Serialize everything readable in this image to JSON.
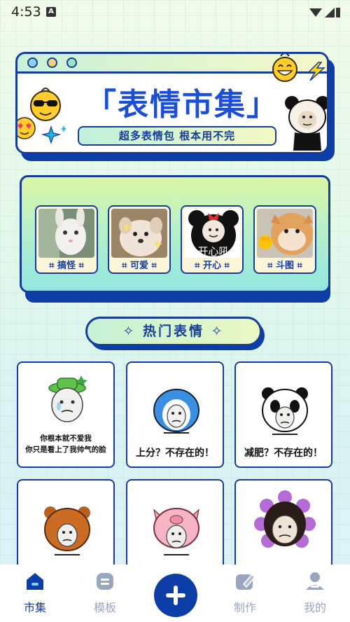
{
  "status_bar": {
    "time": "4:53",
    "notification_glyph": "A"
  },
  "hero": {
    "bracket_left": "「",
    "title": "表情市集",
    "bracket_right": "」",
    "subtitle": "超多表情包 根本用不完"
  },
  "categories": [
    {
      "label": "搞怪"
    },
    {
      "label": "可爱"
    },
    {
      "label": "开心",
      "thumb_text": "开心吼"
    },
    {
      "label": "斗图"
    }
  ],
  "hot_section": {
    "label": "热门表情"
  },
  "stickers": [
    {
      "caption_line1": "你根本就不爱我",
      "caption_line2": "你只是看上了我帅气的脸"
    },
    {
      "caption_line1": "上分？不存在的！"
    },
    {
      "caption_line1": "减肥？不存在的！"
    },
    {
      "caption_line1": ""
    },
    {
      "caption_line1": ""
    },
    {
      "caption_line1": ""
    }
  ],
  "nav": {
    "items": [
      {
        "label": "市集",
        "active": true
      },
      {
        "label": "模板",
        "active": false
      },
      {
        "label": "制作",
        "active": false
      },
      {
        "label": "我的",
        "active": false
      }
    ]
  },
  "colors": {
    "brand_blue": "#163c9e",
    "title_blue": "#1b4fd8",
    "active_nav": "#0d3ea8",
    "inactive_nav": "#9aa6bf"
  }
}
